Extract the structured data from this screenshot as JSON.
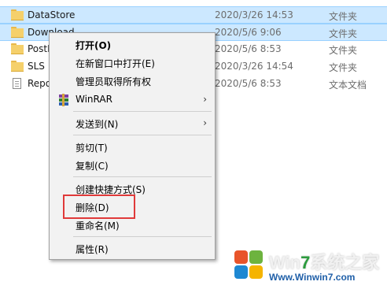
{
  "files": [
    {
      "name": "DataStore",
      "date": "2020/3/26 14:53",
      "type": "文件夹",
      "icon": "folder-icon",
      "selected": true
    },
    {
      "name": "Download",
      "date": "2020/5/6 9:06",
      "type": "文件夹",
      "icon": "folder-icon",
      "selected": true
    },
    {
      "name": "PostR",
      "date": "2020/5/6 8:53",
      "type": "文件夹",
      "icon": "folder-icon",
      "selected": false
    },
    {
      "name": "SLS",
      "date": "2020/3/26 14:54",
      "type": "文件夹",
      "icon": "folder-icon",
      "selected": false
    },
    {
      "name": "Repo",
      "date": "2020/5/6 8:53",
      "type": "文本文档",
      "icon": "text-document-icon",
      "selected": false
    }
  ],
  "context_menu": {
    "items": [
      {
        "label": "打开(O)",
        "bold": true
      },
      {
        "label": "在新窗口中打开(E)"
      },
      {
        "label": "管理员取得所有权"
      },
      {
        "label": "WinRAR",
        "icon": "winrar-icon",
        "submenu": true
      },
      {
        "label": "发送到(N)",
        "submenu": true
      },
      {
        "label": "剪切(T)"
      },
      {
        "label": "复制(C)"
      },
      {
        "label": "创建快捷方式(S)"
      },
      {
        "label": "删除(D)",
        "highlighted": true
      },
      {
        "label": "重命名(M)"
      },
      {
        "label": "属性(R)"
      }
    ],
    "submenu_arrow": "›",
    "highlight_color": "#e03a3a"
  },
  "watermark": {
    "title_part1": "Win",
    "title_part2": "7",
    "title_part3": "系统之家",
    "url": "Www.Winwin7.com"
  },
  "colors": {
    "selection_bg": "#cce8ff",
    "menu_bg": "#f2f2f2",
    "folder": "#f5d06b"
  }
}
